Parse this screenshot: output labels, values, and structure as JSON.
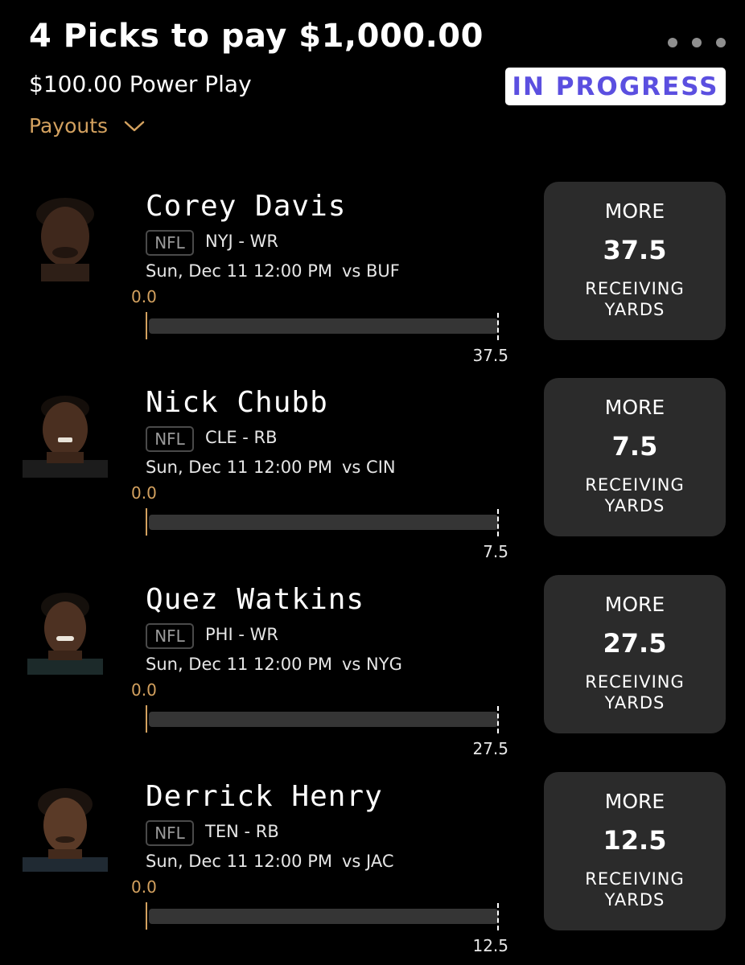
{
  "header": {
    "title": "4 Picks to pay $1,000.00",
    "subtitle": "$100.00 Power Play",
    "status": "IN PROGRESS",
    "payouts_label": "Payouts"
  },
  "colors": {
    "accent_gold": "#d3a15f",
    "status_purple": "#5b4fe0",
    "card_bg": "#2b2b2b"
  },
  "picks": [
    {
      "name": "Corey Davis",
      "league": "NFL",
      "team_pos": "NYJ - WR",
      "game_time": "Sun, Dec 11 12:00 PM",
      "opponent": "vs BUF",
      "current": "0.0",
      "target": "37.5",
      "progress": 0,
      "direction": "MORE",
      "line": "37.5",
      "stat": "RECEIVING YARDS"
    },
    {
      "name": "Nick Chubb",
      "league": "NFL",
      "team_pos": "CLE - RB",
      "game_time": "Sun, Dec 11 12:00 PM",
      "opponent": "vs CIN",
      "current": "0.0",
      "target": "7.5",
      "progress": 0,
      "direction": "MORE",
      "line": "7.5",
      "stat": "RECEIVING YARDS"
    },
    {
      "name": "Quez Watkins",
      "league": "NFL",
      "team_pos": "PHI - WR",
      "game_time": "Sun, Dec 11 12:00 PM",
      "opponent": "vs NYG",
      "current": "0.0",
      "target": "27.5",
      "progress": 0,
      "direction": "MORE",
      "line": "27.5",
      "stat": "RECEIVING YARDS"
    },
    {
      "name": "Derrick Henry",
      "league": "NFL",
      "team_pos": "TEN - RB",
      "game_time": "Sun, Dec 11 12:00 PM",
      "opponent": "vs JAC",
      "current": "0.0",
      "target": "12.5",
      "progress": 0,
      "direction": "MORE",
      "line": "12.5",
      "stat": "RECEIVING YARDS"
    }
  ]
}
